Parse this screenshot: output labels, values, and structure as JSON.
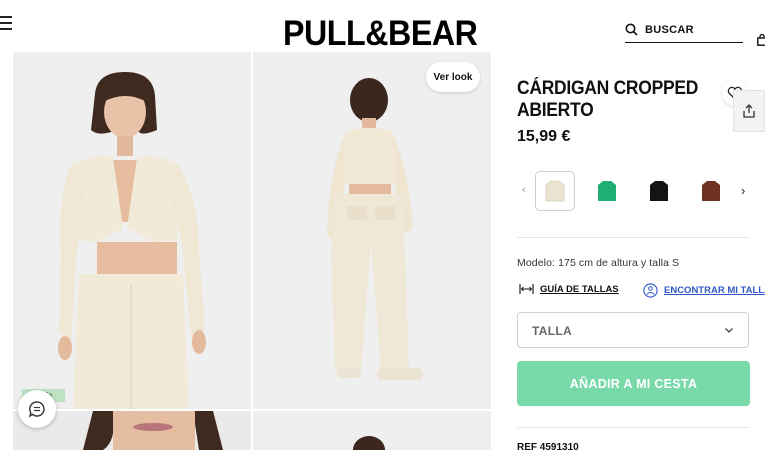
{
  "header": {
    "logo": "PULL&BEAR",
    "search_label": "BUSCAR"
  },
  "gallery": {
    "ver_look_label": "Ver look",
    "badge_text": "life"
  },
  "product": {
    "title": "CÁRDIGAN CROPPED ABIERTO",
    "price": "15,99 €",
    "swatches": [
      {
        "name": "crudo",
        "color": "#ece4d3",
        "selected": true
      },
      {
        "name": "verde",
        "color": "#1fae74",
        "selected": false
      },
      {
        "name": "negro",
        "color": "#141414",
        "selected": false
      },
      {
        "name": "marron",
        "color": "#6e3223",
        "selected": false
      }
    ],
    "model_info": "Modelo: 175 cm de altura y talla S",
    "size_guide_label": "GUÍA DE TALLAS",
    "find_size_label": "ENCONTRAR MI TALLA",
    "size_select_label": "TALLA",
    "add_to_cart_label": "AÑADIR A MI CESTA",
    "reference": "REF 4591310"
  },
  "colors": {
    "accent": "#79d9a9",
    "link_blue": "#2f58c9",
    "background": "#ffffff",
    "photo_bg": "#f1f1f1"
  }
}
